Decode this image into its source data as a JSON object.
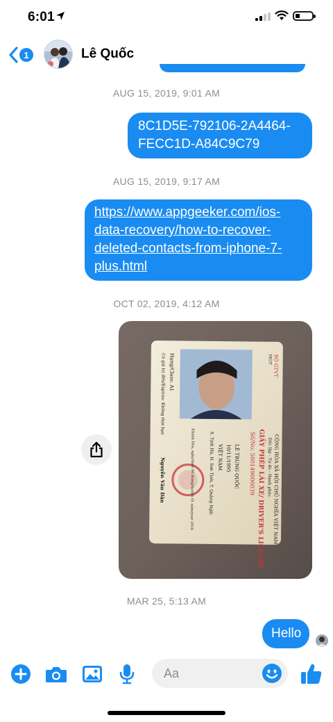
{
  "status_bar": {
    "time": "6:01",
    "battery_level": 0.25
  },
  "header": {
    "back_badge": "1",
    "contact_name": "Lê Quốc"
  },
  "messages": [
    {
      "timestamp": "AUG 15, 2019, 9:01 AM",
      "lines": [
        "8C1D5E-792106-2A4464-",
        "FECC1D-A84C9C79"
      ]
    },
    {
      "timestamp": "AUG 15, 2019, 9:17 AM",
      "link_lines": [
        "https://www.appgeeker.com/ios-",
        "data-recovery/how-to-recover-",
        "deleted-contacts-from-iphone-7-",
        "plus.html"
      ]
    },
    {
      "timestamp": "OCT 02, 2019, 4:12 AM",
      "photo_card_text": {
        "ministry": "BỘ GTVT",
        "ministry_en": "MOT",
        "country": "CỘNG HÒA XÃ HỘI CHỦ NGHĨA VIỆT NAM",
        "motto": "Độc lập - Tự do - Hạnh phúc",
        "title": "GIẤY PHÉP LÁI XE/ DRIVER'S LICENSE",
        "number": "Số/No: 560149000039",
        "name": "LÊ TRUNG QUỐC",
        "dob": "10/11/1995",
        "nationality": "VIỆT NAM",
        "address": "X. Tịnh Hà, H. Sơn Tịnh, T. Quảng Ngãi",
        "class": "Hạng/Class: A1",
        "validity": "Có giá trị đến/Expires: Không thời hạn",
        "issuer": "Nguyễn Văn Dân",
        "issue_place": "Khánh Hòa, ngày/date 06 tháng/month 01 năm/year 2014"
      }
    },
    {
      "timestamp": "MAR 25, 5:13 AM",
      "lines": [
        "Hello"
      ]
    }
  ],
  "composer": {
    "placeholder": "Aa"
  },
  "colors": {
    "accent": "#1a8cf1",
    "timestamp": "#8a8d91",
    "input_bg": "#f0f0f0"
  },
  "icons": [
    "location-arrow-icon",
    "signal-icon",
    "wifi-icon",
    "battery-icon",
    "back-chevron-icon",
    "share-icon",
    "plus-icon",
    "camera-icon",
    "image-icon",
    "microphone-icon",
    "emoji-icon",
    "thumbs-up-icon"
  ]
}
